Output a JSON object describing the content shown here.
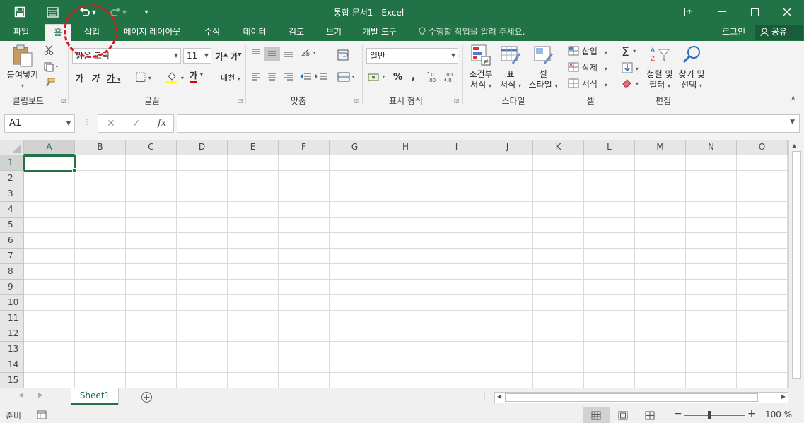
{
  "title": {
    "text": "통합 문서1 - Excel"
  },
  "tabs": [
    {
      "label": "파일"
    },
    {
      "label": "홈"
    },
    {
      "label": "삽입"
    },
    {
      "label": "페이지 레이아웃"
    },
    {
      "label": "수식"
    },
    {
      "label": "데이터"
    },
    {
      "label": "검토"
    },
    {
      "label": "보기"
    },
    {
      "label": "개발 도구"
    }
  ],
  "tellme": "수행할 작업을 알려 주세요.",
  "signin": "로그인",
  "share": "공유",
  "ribbon": {
    "clipboard": {
      "paste": "붙여넣기",
      "label": "클립보드"
    },
    "font": {
      "name": "맑은 고딕",
      "size": "11",
      "label": "글꼴",
      "bold": "가",
      "italic": "가",
      "underline": "가",
      "color": "가",
      "grow": "가",
      "shrink": "가",
      "phonetic": "내천"
    },
    "alignment": {
      "label": "맞춤"
    },
    "number": {
      "format": "일반",
      "label": "표시 형식",
      "percent": "%",
      "comma": ","
    },
    "styles": {
      "conditional": "조건부",
      "conditional2": "서식",
      "table": "표",
      "table2": "서식",
      "cell": "셀",
      "cell2": "스타일",
      "label": "스타일"
    },
    "cells": {
      "insert": "삽입",
      "delete": "삭제",
      "format": "서식",
      "label": "셀"
    },
    "editing": {
      "sort": "정렬 및",
      "sort2": "필터",
      "find": "찾기 및",
      "find2": "선택",
      "label": "편집"
    }
  },
  "namebox": "A1",
  "fx": "fx",
  "columns": [
    "A",
    "B",
    "C",
    "D",
    "E",
    "F",
    "G",
    "H",
    "I",
    "J",
    "K",
    "L",
    "M",
    "N",
    "O"
  ],
  "rows": [
    "1",
    "2",
    "3",
    "4",
    "5",
    "6",
    "7",
    "8",
    "9",
    "10",
    "11",
    "12",
    "13",
    "14",
    "15"
  ],
  "sheet": {
    "name": "Sheet1"
  },
  "status": {
    "ready": "준비",
    "zoom": "100 %"
  },
  "colors": {
    "brand": "#217346",
    "annotation": "#d71920"
  }
}
